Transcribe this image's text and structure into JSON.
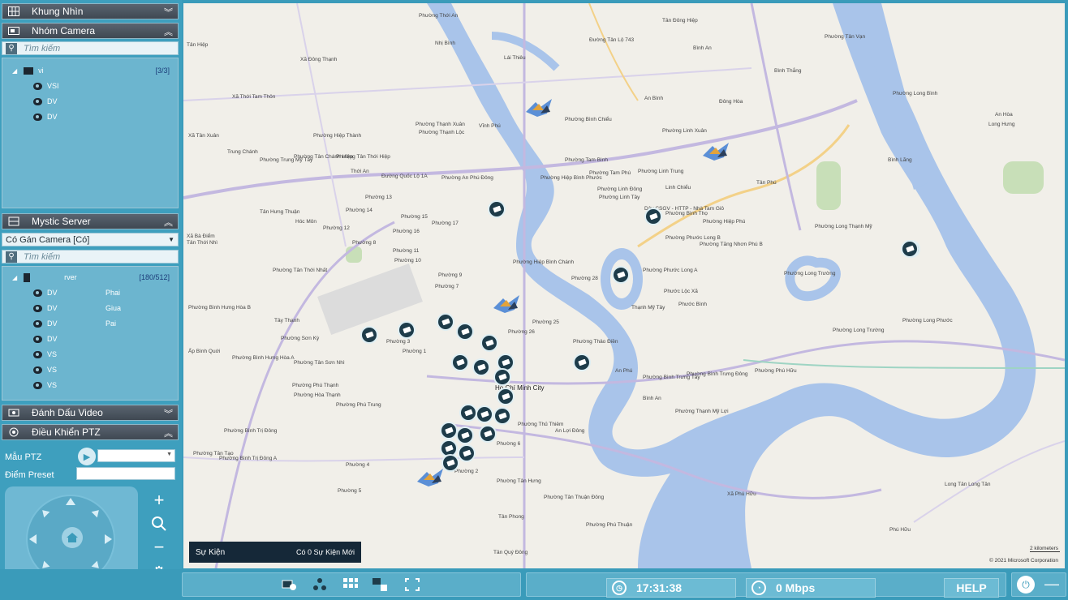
{
  "sidebar": {
    "view_panel": {
      "title": "Khung Nhìn"
    },
    "camera_group_panel": {
      "title": "Nhóm Camera",
      "search_placeholder": "Tìm kiếm",
      "root": {
        "name": "vi",
        "count": "[3/3]"
      },
      "items": [
        "VSI",
        "DV",
        "DV"
      ]
    },
    "server_panel": {
      "title": "Mystic Server",
      "filter_value": "Có Gán Camera [Có]",
      "search_placeholder": "Tìm kiếm",
      "root": {
        "name": "rver",
        "count": "[180/512]"
      },
      "items": [
        "DV",
        "DV",
        "DV",
        "DV",
        "VS",
        "VS",
        "VS"
      ],
      "item_suffixes": [
        "Phai",
        "Giua",
        "Pai",
        "",
        "",
        "",
        ""
      ]
    },
    "video_bookmark_panel": {
      "title": "Đánh Dấu Video"
    },
    "ptz_panel": {
      "title": "Điều Khiển PTZ",
      "pattern_label": "Mẫu PTZ",
      "preset_label": "Điểm Preset"
    }
  },
  "map": {
    "labels": [
      "Phường Thới An",
      "Tân Đông Hiệp",
      "Phường Tân Vạn",
      "Đường Tân Lộ 743",
      "Tân Hiệp",
      "Nhị Bình",
      "Lái Thiêu",
      "Bình An",
      "Xã Đông Thạnh",
      "Bình Thắng",
      "Xã Thới Tam Thôn",
      "An Bình",
      "Đông Hòa",
      "Phường Long Bình",
      "An Hòa",
      "Long Hưng",
      "Phường Hiệp Thành",
      "Phường Thạnh Xuân",
      "Phường Thạnh Lộc",
      "Vĩnh Phú",
      "Phường Bình Chiểu",
      "Phường Linh Xuân",
      "Xã Tân Xuân",
      "Trung Chánh",
      "Phường Tân Chánh Hiệp",
      "Phường Tân Thới Hiệp",
      "Phường Trung Mỹ Tây",
      "Phường Tam Bình",
      "Phường Tam Phú",
      "Thới An",
      "Đường Quốc Lộ 1A",
      "Phường An Phú Đông",
      "Phường Hiệp Bình Phước",
      "Phường Linh Trung",
      "Tân Phú",
      "Bình Lãng",
      "Phường 13",
      "Phường 14",
      "Phường 15",
      "Phường 17",
      "Phường Linh Đông",
      "Phường Linh Tây",
      "Linh Chiểu",
      "Tân Hưng Thuận",
      "Hóc Môn",
      "Phường 12",
      "Phường 16",
      "Phường Bình Thọ",
      "Phường Phước Long B",
      "Phường Tăng Nhơn Phú B",
      "Phường Hiệp Phú",
      "Phường Long Thạnh Mỹ",
      "Xã Bà Điểm",
      "Tân Thới Nhì",
      "Phường 8",
      "Phường 11",
      "Phường 10",
      "Phường Tân Thới Nhất",
      "Phường Hiệp Bình Chánh",
      "Phường 28",
      "Phường Phước Long A",
      "Phước Lộc Xã",
      "Phường Long Trường",
      "Phường Long Phước",
      "Phường Bình Hưng Hòa B",
      "Tây Thạnh",
      "Phường 9",
      "Phường 7",
      "Phường 25",
      "Phường 26",
      "Thạnh Mỹ Tây",
      "Phước Bình",
      "Phường Sơn Kỳ",
      "Phường Thảo Điền",
      "An Phú",
      "Phường Long Trường",
      "Ấp Bình Quới",
      "Phường Bình Hưng Hòa A",
      "Phường Tân Sơn Nhì",
      "Phường Hòa Thạnh",
      "Phường Phú Thạnh",
      "Phường Phú Trung",
      "Phường Bình Trưng Tây",
      "Phường Bình Trưng Đông",
      "Phường Phú Hữu",
      "Bình An",
      "Phường Thạnh Mỹ Lợi",
      "Phường Bình Trị Đông",
      "Phường Thủ Thiêm",
      "An Lợi Đông",
      "Phường Tân Tạo",
      "Phường Bình Trị Đông A",
      "Phường 4",
      "Phường 5",
      "Phường 2",
      "Phường 6",
      "Phường Tân Hưng",
      "Tân Phong",
      "Phường Phú Thuận",
      "Xã Phú Hữu",
      "Long Tân Long Tân",
      "Phú Hữu",
      "Tân Quý Đông",
      "Phường Tân Thuận Đông",
      "Phường 3",
      "Phường 1"
    ],
    "sign": "Dây CSGV - HTTP - Nhà Tam Giô",
    "city": "Hồ Chí Minh City",
    "scale_text": "2 kilometers",
    "credit": "© 2021 Microsoft Corporation"
  },
  "events": {
    "title": "Sự Kiện",
    "status": "Có 0 Sự Kiện Mới"
  },
  "statusbar": {
    "time": "17:31:38",
    "bandwidth": "0 Mbps",
    "help_label": "HELP"
  },
  "colors": {
    "accent": "#3a9bba",
    "panel_header": "#4a535d",
    "map_bg": "#f1efe9",
    "water": "#a9c4ea",
    "marker": "#1e3c4a"
  }
}
